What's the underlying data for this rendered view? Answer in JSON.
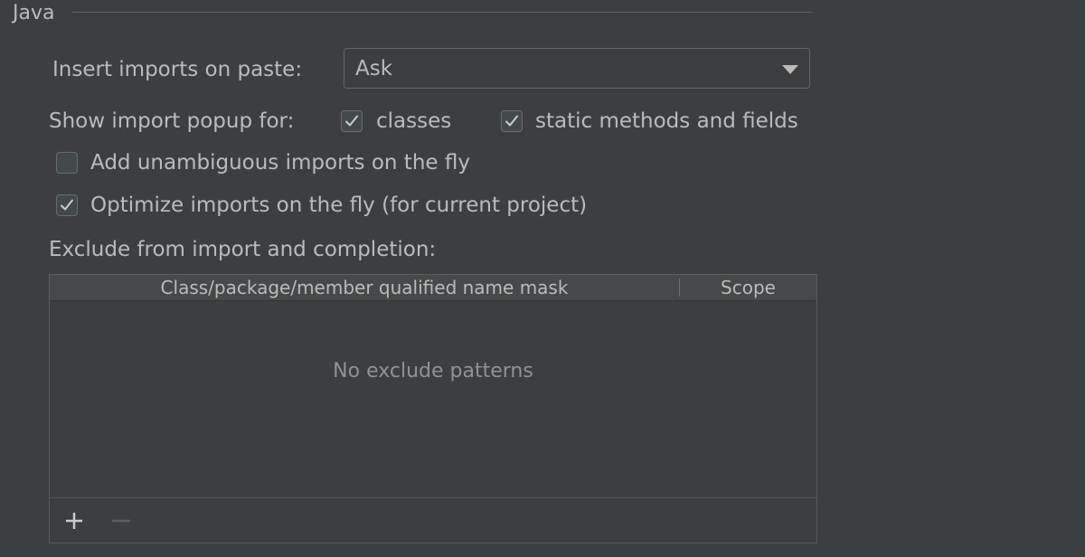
{
  "section": {
    "title": "Java"
  },
  "paste": {
    "label": "Insert imports on paste:",
    "selected": "Ask"
  },
  "popup": {
    "label": "Show import popup for:",
    "classes": {
      "label": "classes",
      "checked": true
    },
    "static": {
      "label": "static methods and fields",
      "checked": true
    }
  },
  "options": {
    "unambiguous": {
      "label": "Add unambiguous imports on the fly",
      "checked": false
    },
    "optimize": {
      "label": "Optimize imports on the fly (for current project)",
      "checked": true
    }
  },
  "exclude": {
    "label": "Exclude from import and completion:",
    "columns": [
      "Class/package/member qualified name mask",
      "Scope"
    ],
    "empty_text": "No exclude patterns",
    "toolbar": {
      "add": "add-icon",
      "remove": "remove-icon"
    }
  },
  "colors": {
    "background": "#3c3f41",
    "text": "#bbbbbb",
    "muted_text": "#8f9294"
  }
}
